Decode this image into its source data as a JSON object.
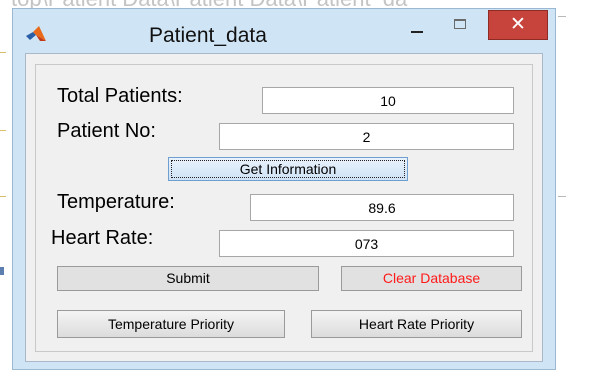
{
  "background": {
    "path_text": "ktop\\Patient Data\\Patient Data\\Patient_da"
  },
  "window": {
    "title": "Patient_data",
    "controls": {
      "minimize": "—",
      "close": "✕"
    },
    "colors": {
      "frame": "#cfe4f5",
      "close_button": "#c7443c",
      "clear_text": "#ff1a1a"
    }
  },
  "form": {
    "total_patients": {
      "label": "Total Patients:",
      "value": "10"
    },
    "patient_no": {
      "label": "Patient No:",
      "value": "2"
    },
    "get_information_label": "Get Information",
    "temperature": {
      "label": "Temperature:",
      "value": "89.6"
    },
    "heart_rate": {
      "label": "Heart Rate:",
      "value": "073"
    },
    "submit_label": "Submit",
    "clear_database_label": "Clear Database",
    "temperature_priority_label": "Temperature Priority",
    "heart_rate_priority_label": "Heart Rate Priority"
  },
  "icons": {
    "app": "matlab-logo-icon",
    "minimize": "minimize-icon",
    "maximize": "maximize-icon",
    "close": "close-icon"
  }
}
